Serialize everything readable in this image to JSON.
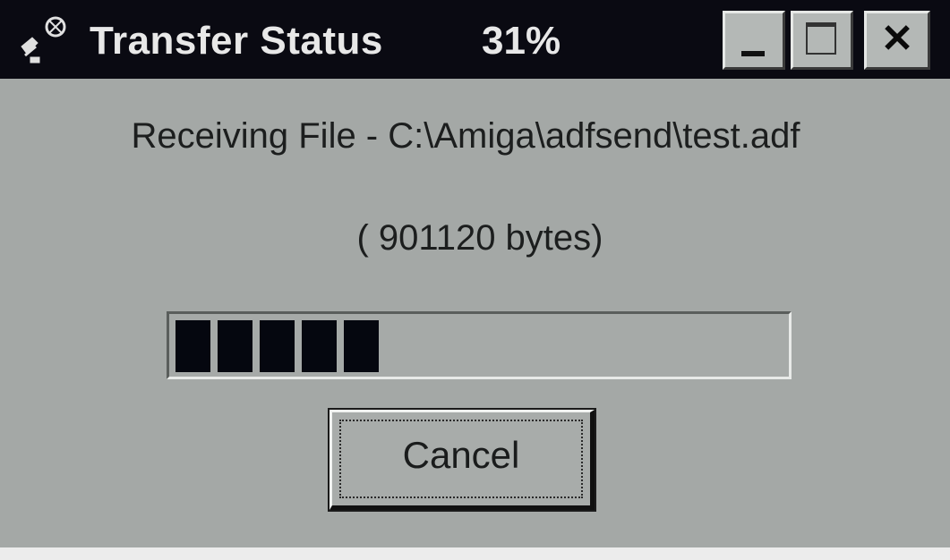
{
  "window": {
    "title": "Transfer Status",
    "percent": "31%"
  },
  "titlebar_buttons": {
    "minimize_icon": "minimize-icon",
    "maximize_icon": "maximize-icon",
    "close_glyph": "✕",
    "close_icon": "close-icon"
  },
  "message": {
    "receiving": "Receiving File - C:\\Amiga\\adfsend\\test.adf",
    "size": "( 901120 bytes)"
  },
  "progress": {
    "value_percent": 31,
    "filled_blocks": 5
  },
  "actions": {
    "cancel_label": "Cancel"
  },
  "colors": {
    "titlebar": "#0a0a12",
    "window_bg": "#a4a8a6",
    "progress_fill": "#05070f"
  }
}
